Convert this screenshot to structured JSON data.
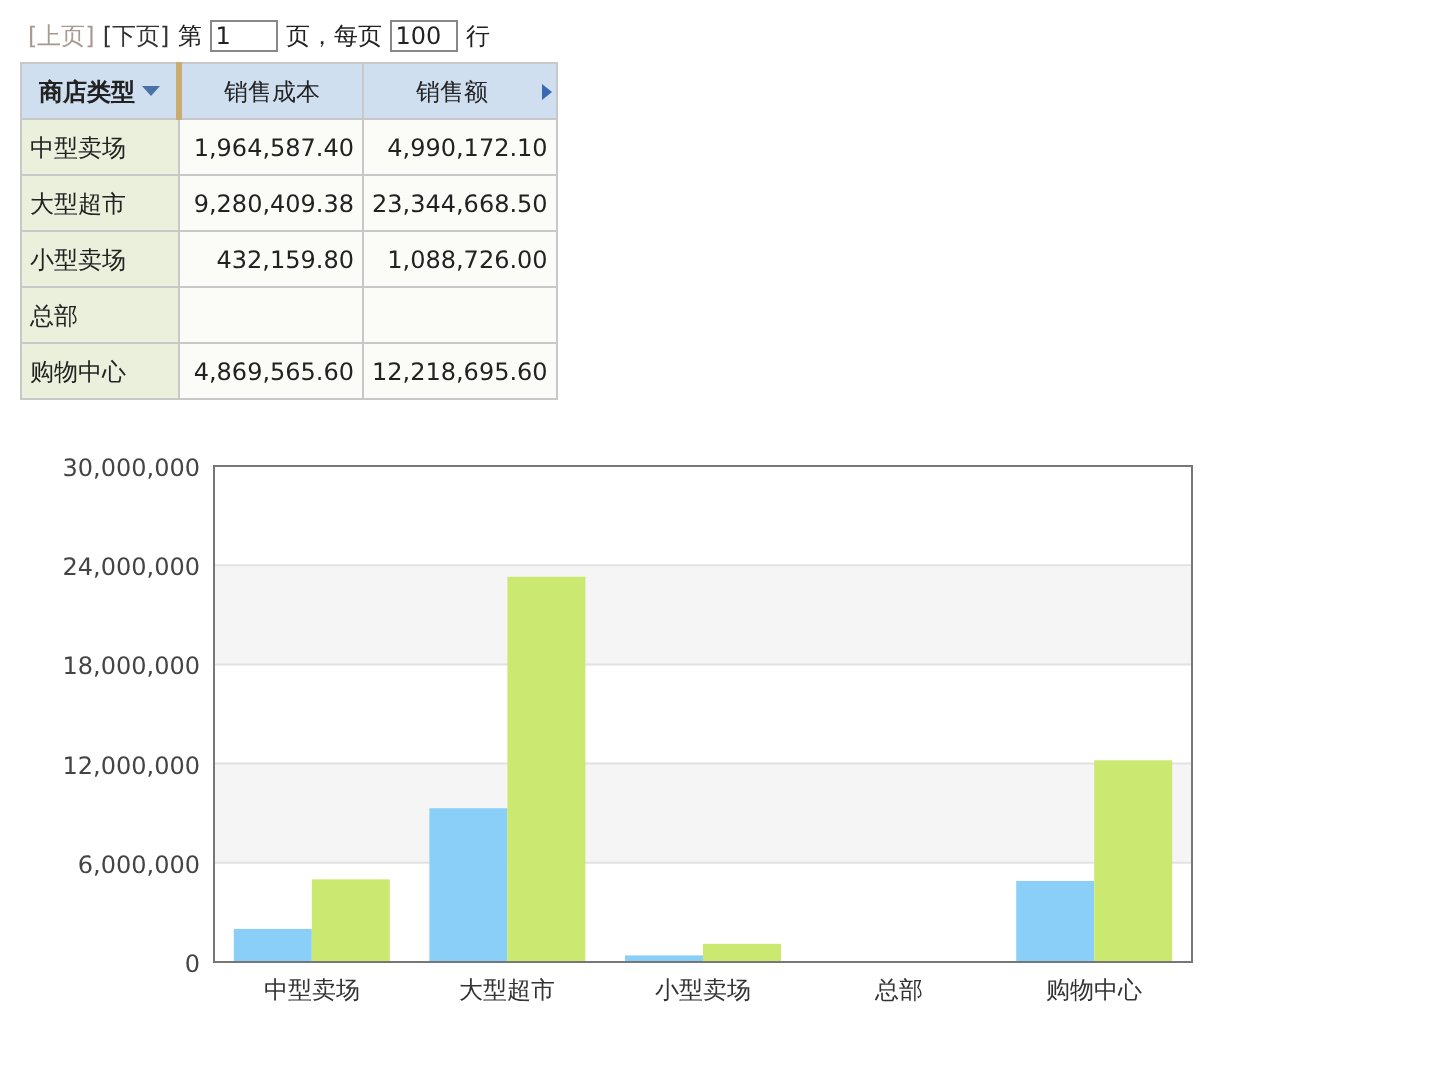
{
  "pager": {
    "links": [
      {
        "label": "[上页]",
        "disabled": true
      },
      {
        "label": "[下页]",
        "disabled": false
      }
    ],
    "page_prefix": "第",
    "page_value": "1",
    "page_suffix": "页，每页",
    "rows_value": "100",
    "rows_suffix": "行"
  },
  "table": {
    "columns": [
      {
        "label": "商店类型",
        "kind": "dimension"
      },
      {
        "label": "销售成本",
        "kind": "measure"
      },
      {
        "label": "销售额",
        "kind": "last"
      }
    ],
    "rows": [
      [
        "中型卖场",
        "1,964,587.40",
        "4,990,172.10"
      ],
      [
        "大型超市",
        "9,280,409.38",
        "23,344,668.50"
      ],
      [
        "小型卖场",
        "432,159.80",
        "1,088,726.00"
      ],
      [
        "总部",
        "",
        ""
      ],
      [
        "购物中心",
        "4,869,565.60",
        "12,218,695.60"
      ]
    ]
  },
  "chart": {
    "chart_data": {
      "type": "bar",
      "categories": [
        "中型卖场",
        "大型超市",
        "小型卖场",
        "总部",
        "购物中心"
      ],
      "series": [
        {
          "color": "#8acff8",
          "values": [
            2000000,
            9300000,
            400000,
            null,
            4900000
          ]
        },
        {
          "color": "#cbe970",
          "values": [
            5000000,
            23300000,
            1100000,
            null,
            12200000
          ]
        }
      ],
      "grid": true,
      "ylim": [
        0,
        30000000
      ],
      "yticks": [
        {
          "value": 0,
          "label": "0"
        },
        {
          "value": 6000000,
          "label": "6,000,000"
        },
        {
          "value": 12000000,
          "label": "12,000,000"
        },
        {
          "value": 18000000,
          "label": "18,000,000"
        },
        {
          "value": 24000000,
          "label": "24,000,000"
        },
        {
          "value": 30000000,
          "label": "30,000,000"
        }
      ]
    }
  }
}
